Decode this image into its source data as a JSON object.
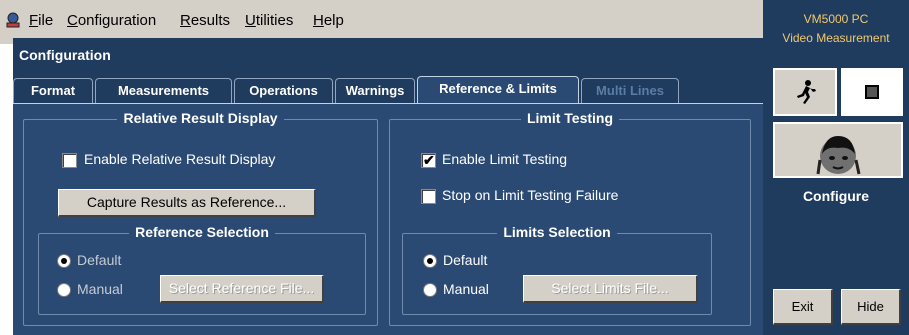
{
  "menu": {
    "items": [
      {
        "first": "F",
        "rest": "ile"
      },
      {
        "first": "C",
        "rest": "onfiguration"
      },
      {
        "first": "R",
        "rest": "esults"
      },
      {
        "first": "U",
        "rest": "tilities"
      },
      {
        "first": "H",
        "rest": "elp"
      }
    ]
  },
  "window": {
    "title": "Configuration"
  },
  "tabs": [
    {
      "label": "Format"
    },
    {
      "label": "Measurements"
    },
    {
      "label": "Operations"
    },
    {
      "label": "Warnings"
    },
    {
      "label": "Reference & Limits",
      "active": true
    },
    {
      "label": "Multi Lines",
      "disabled": true
    }
  ],
  "relative": {
    "title": "Relative Result Display",
    "enable_label": "Enable Relative Result Display",
    "enable_checked": false,
    "capture_button": "Capture Results as Reference...",
    "reference": {
      "title": "Reference Selection",
      "default_label": "Default",
      "manual_label": "Manual",
      "selected": "Default",
      "select_file_button": "Select Reference File..."
    }
  },
  "limits": {
    "title": "Limit Testing",
    "enable_label": "Enable Limit Testing",
    "enable_checked": true,
    "stop_label": "Stop on Limit Testing Failure",
    "stop_checked": false,
    "selection": {
      "title": "Limits Selection",
      "default_label": "Default",
      "manual_label": "Manual",
      "selected": "Default",
      "select_file_button": "Select Limits File..."
    }
  },
  "sidebar": {
    "product": "VM5000 PC",
    "subtitle": "Video Measurement",
    "mode_label": "Configure",
    "exit_button": "Exit",
    "hide_button": "Hide"
  },
  "colors": {
    "panel": "#2a4a73",
    "frame": "#1f3b5e",
    "accent": "#f2c96a"
  },
  "icons": [
    "app-icon",
    "run-icon",
    "stop-icon",
    "face-icon"
  ]
}
